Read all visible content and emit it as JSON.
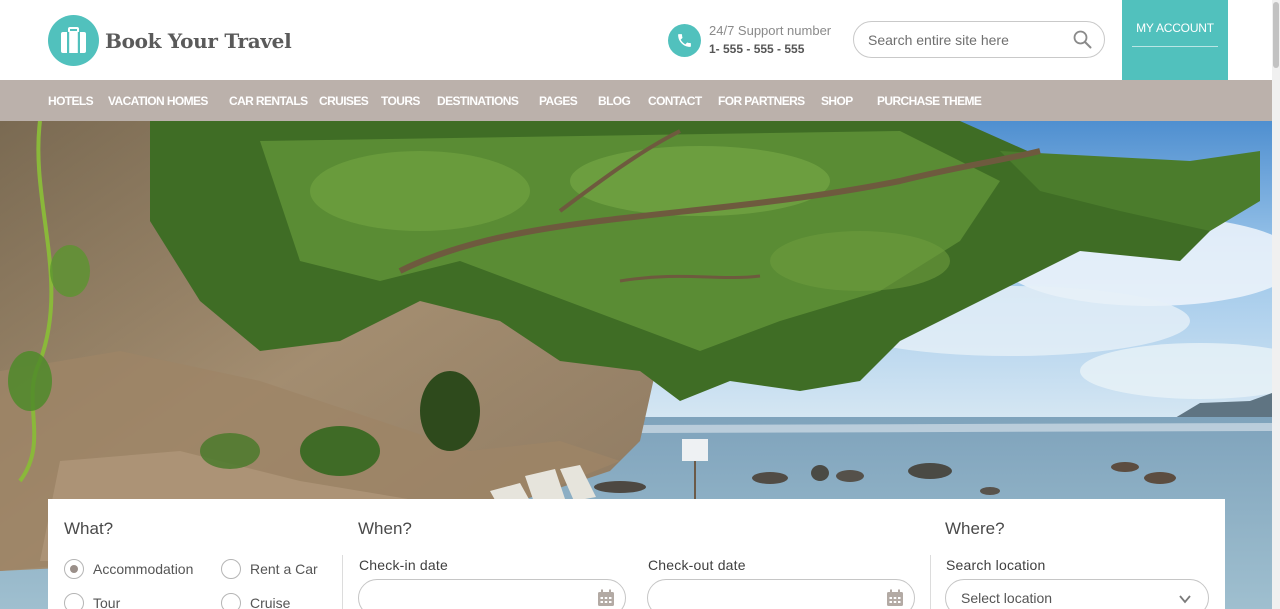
{
  "brand": {
    "name": "Book Your Travel",
    "accent": "#51c1bd",
    "nav_bg": "#bbb1ab"
  },
  "support": {
    "label": "24/7 Support number",
    "number": "1- 555 - 555 - 555"
  },
  "search": {
    "placeholder": "Search entire site here"
  },
  "account": {
    "label": "MY ACCOUNT"
  },
  "nav": {
    "items": [
      "HOTELS",
      "VACATION HOMES",
      "CAR RENTALS",
      "CRUISES",
      "TOURS",
      "DESTINATIONS",
      "PAGES",
      "BLOG",
      "CONTACT",
      "FOR PARTNERS",
      "SHOP",
      "PURCHASE THEME"
    ]
  },
  "search_panel": {
    "what": {
      "title": "What?",
      "options": [
        {
          "label": "Accommodation",
          "selected": true
        },
        {
          "label": "Rent a Car",
          "selected": false
        },
        {
          "label": "Tour",
          "selected": false
        },
        {
          "label": "Cruise",
          "selected": false
        }
      ]
    },
    "when": {
      "title": "When?",
      "checkin_label": "Check-in date",
      "checkout_label": "Check-out date"
    },
    "where": {
      "title": "Where?",
      "location_label": "Search location",
      "location_value": "Select location"
    }
  }
}
